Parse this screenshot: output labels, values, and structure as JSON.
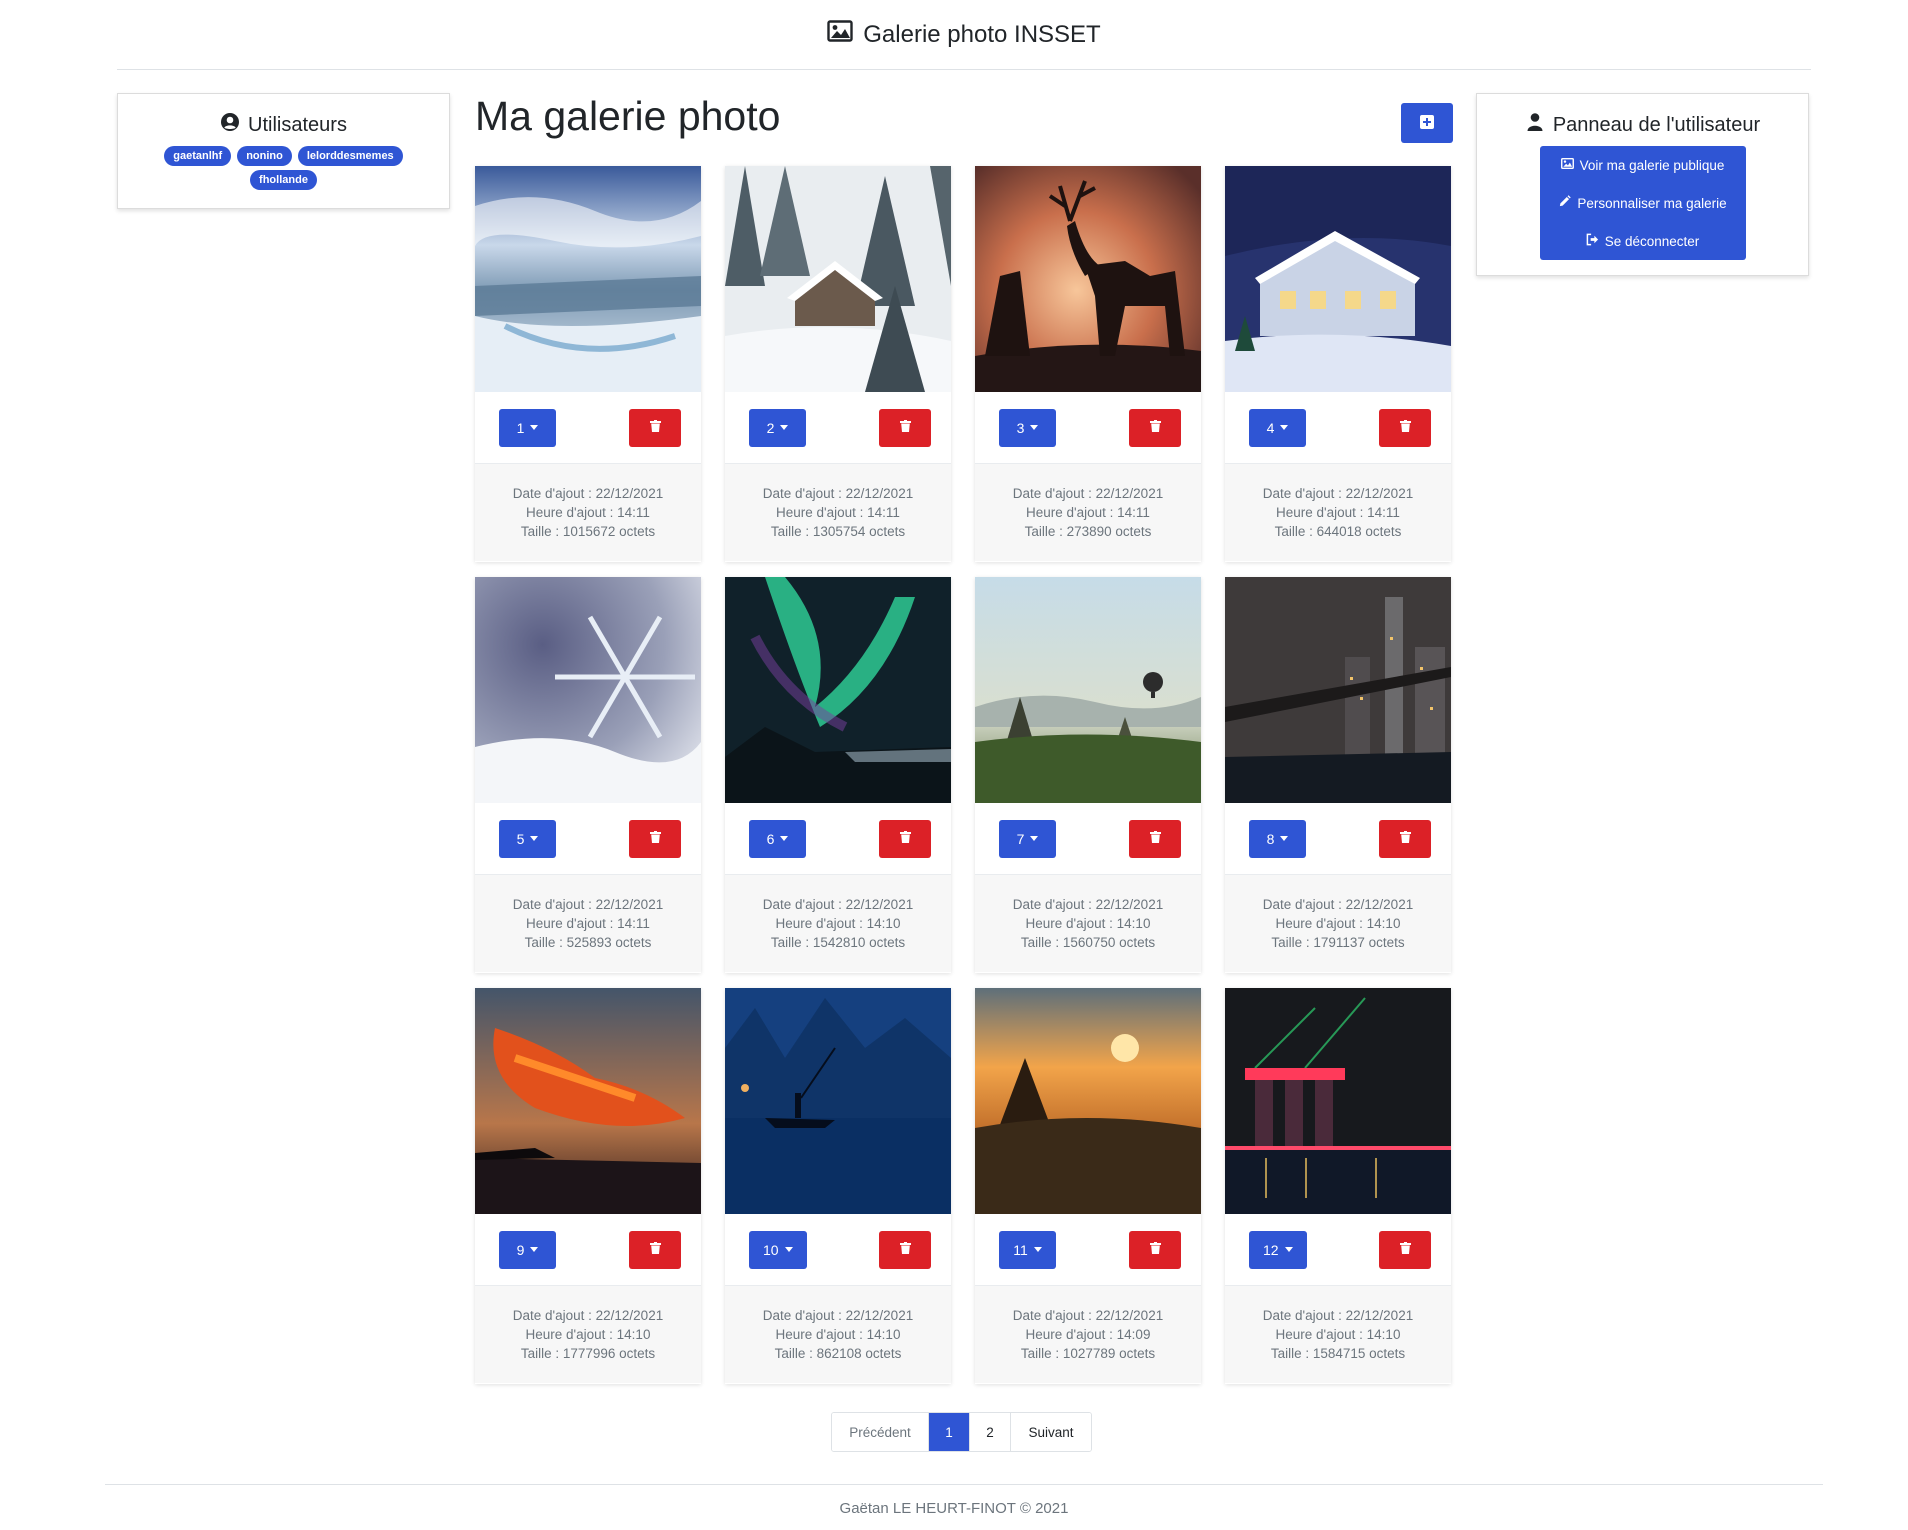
{
  "header": {
    "brand": "Galerie photo INSSET",
    "brand_icon": "image-icon"
  },
  "users": {
    "title": "Utilisateurs",
    "list": [
      "gaetanlhf",
      "nonino",
      "lelorddesmemes",
      "fhollande"
    ]
  },
  "panel": {
    "title": "Panneau de l'utilisateur",
    "items": [
      {
        "label": "Voir ma galerie publique",
        "icon": "image-icon"
      },
      {
        "label": "Personnaliser ma galerie",
        "icon": "pencil-icon"
      },
      {
        "label": "Se déconnecter",
        "icon": "sign-out-icon"
      }
    ]
  },
  "main": {
    "title": "Ma galerie photo",
    "add_icon": "plus-square-icon"
  },
  "photos": [
    {
      "number": "1",
      "scene": "frozen waterfall",
      "date": "Date d'ajout : 22/12/2021",
      "time": "Heure d'ajout : 14:11",
      "size": "Taille : 1015672 octets"
    },
    {
      "number": "2",
      "scene": "snowy cabin in forest",
      "date": "Date d'ajout : 22/12/2021",
      "time": "Heure d'ajout : 14:11",
      "size": "Taille : 1305754 octets"
    },
    {
      "number": "3",
      "scene": "deer silhouettes at sunset",
      "date": "Date d'ajout : 22/12/2021",
      "time": "Heure d'ajout : 14:11",
      "size": "Taille : 273890 octets"
    },
    {
      "number": "4",
      "scene": "house in snow at night",
      "date": "Date d'ajout : 22/12/2021",
      "time": "Heure d'ajout : 14:11",
      "size": "Taille : 644018 octets"
    },
    {
      "number": "5",
      "scene": "snowflake macro",
      "date": "Date d'ajout : 22/12/2021",
      "time": "Heure d'ajout : 14:11",
      "size": "Taille : 525893 octets"
    },
    {
      "number": "6",
      "scene": "aurora borealis",
      "date": "Date d'ajout : 22/12/2021",
      "time": "Heure d'ajout : 14:10",
      "size": "Taille : 1542810 octets"
    },
    {
      "number": "7",
      "scene": "temples and hot air balloon",
      "date": "Date d'ajout : 22/12/2021",
      "time": "Heure d'ajout : 14:10",
      "size": "Taille : 1560750 octets"
    },
    {
      "number": "8",
      "scene": "city bridge at night",
      "date": "Date d'ajout : 22/12/2021",
      "time": "Heure d'ajout : 14:10",
      "size": "Taille : 1791137 octets"
    },
    {
      "number": "9",
      "scene": "red sunset clouds over sea",
      "date": "Date d'ajout : 22/12/2021",
      "time": "Heure d'ajout : 14:10",
      "size": "Taille : 1777996 octets"
    },
    {
      "number": "10",
      "scene": "fisherman on blue river",
      "date": "Date d'ajout : 22/12/2021",
      "time": "Heure d'ajout : 14:10",
      "size": "Taille : 862108 octets"
    },
    {
      "number": "11",
      "scene": "golden sunrise over temple",
      "date": "Date d'ajout : 22/12/2021",
      "time": "Heure d'ajout : 14:09",
      "size": "Taille : 1027789 octets"
    },
    {
      "number": "12",
      "scene": "city skyline light show",
      "date": "Date d'ajout : 22/12/2021",
      "time": "Heure d'ajout : 14:10",
      "size": "Taille : 1584715 octets"
    }
  ],
  "pagination": {
    "prev": "Précédent",
    "pages": [
      "1",
      "2"
    ],
    "active": "1",
    "next": "Suivant"
  },
  "footer": {
    "text": "Gaëtan LE HEURT-FINOT © 2021"
  },
  "colors": {
    "primary": "#2f55d4",
    "danger": "#dc2127",
    "muted": "#6c757d"
  }
}
